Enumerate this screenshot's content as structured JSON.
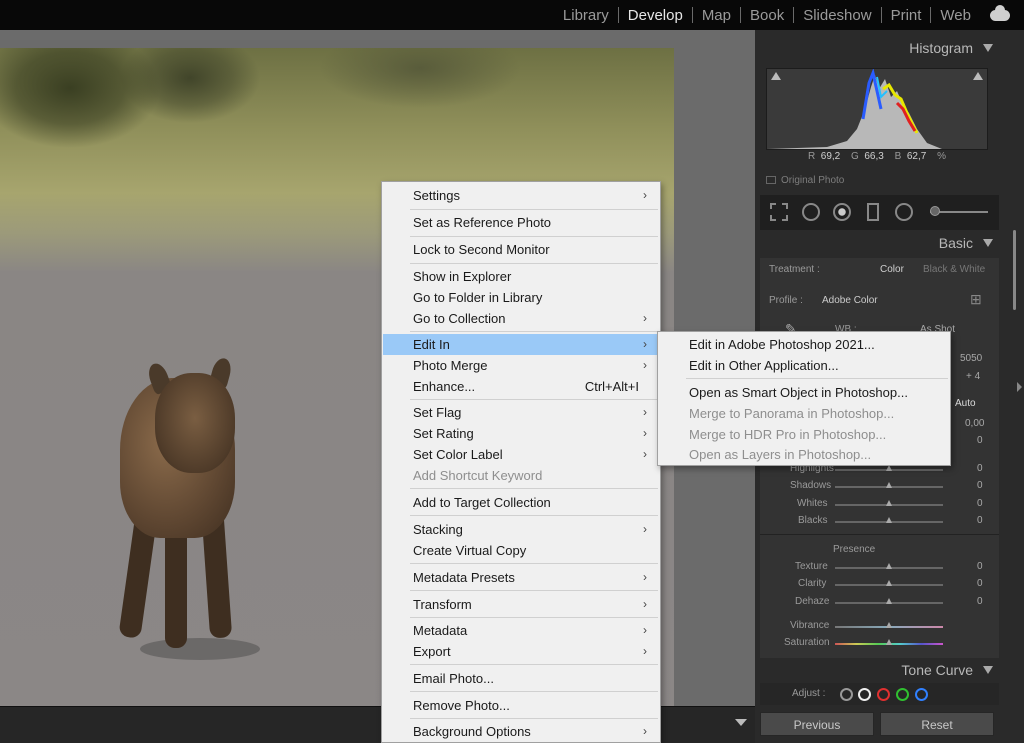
{
  "modules": [
    "Library",
    "Develop",
    "Map",
    "Book",
    "Slideshow",
    "Print",
    "Web"
  ],
  "active_module": "Develop",
  "panel": {
    "histogram_label": "Histogram",
    "rgb": {
      "r_label": "R",
      "r": "69,2",
      "g_label": "G",
      "g": "66,3",
      "b_label": "B",
      "b": "62,7",
      "unit": "%"
    },
    "original_photo": "Original Photo",
    "basic_label": "Basic",
    "treatment_label": "Treatment :",
    "treatment_color": "Color",
    "treatment_bw": "Black & White",
    "profile_label": "Profile :",
    "profile_value": "Adobe Color",
    "wb_label": "WB :",
    "wb_value": "As Shot",
    "temp_value": "5050",
    "tint_value": "+ 4",
    "auto_label": "Auto",
    "exposure_value": "0,00",
    "contrast_value": "0",
    "sliders": [
      {
        "label": "Highlights",
        "value": "0"
      },
      {
        "label": "Shadows",
        "value": "0"
      },
      {
        "label": "Whites",
        "value": "0"
      },
      {
        "label": "Blacks",
        "value": "0"
      }
    ],
    "presence_label": "Presence",
    "presence_sliders": [
      {
        "label": "Texture",
        "value": "0"
      },
      {
        "label": "Clarity",
        "value": "0"
      },
      {
        "label": "Dehaze",
        "value": "0"
      },
      {
        "label": "Vibrance",
        "value": ""
      },
      {
        "label": "Saturation",
        "value": ""
      }
    ],
    "tone_curve_label": "Tone Curve",
    "adjust_label": "Adjust :",
    "previous_label": "Previous",
    "reset_label": "Reset"
  },
  "context_menu": {
    "items": [
      {
        "label": "Settings",
        "submenu": true
      },
      {
        "label": "Set as Reference Photo"
      },
      {
        "label": "Lock to Second Monitor"
      },
      {
        "label": "Show in Explorer"
      },
      {
        "label": "Go to Folder in Library"
      },
      {
        "label": "Go to Collection",
        "submenu": true
      },
      {
        "label": "Edit In",
        "submenu": true,
        "highlighted": true
      },
      {
        "label": "Photo Merge",
        "submenu": true
      },
      {
        "label": "Enhance...",
        "shortcut": "Ctrl+Alt+I"
      },
      {
        "label": "Set Flag",
        "submenu": true
      },
      {
        "label": "Set Rating",
        "submenu": true
      },
      {
        "label": "Set Color Label",
        "submenu": true
      },
      {
        "label": "Add Shortcut Keyword",
        "disabled": true
      },
      {
        "label": "Add to Target Collection"
      },
      {
        "label": "Stacking",
        "submenu": true
      },
      {
        "label": "Create Virtual Copy"
      },
      {
        "label": "Metadata Presets",
        "submenu": true
      },
      {
        "label": "Transform",
        "submenu": true
      },
      {
        "label": "Metadata",
        "submenu": true
      },
      {
        "label": "Export",
        "submenu": true
      },
      {
        "label": "Email Photo..."
      },
      {
        "label": "Remove Photo..."
      },
      {
        "label": "Background Options",
        "submenu": true
      }
    ]
  },
  "edit_in_submenu": {
    "items": [
      {
        "label": "Edit in Adobe Photoshop 2021..."
      },
      {
        "label": "Edit in Other Application..."
      },
      {
        "label": "Open as Smart Object in Photoshop..."
      },
      {
        "label": "Merge to Panorama in Photoshop...",
        "disabled": true
      },
      {
        "label": "Merge to HDR Pro in Photoshop...",
        "disabled": true
      },
      {
        "label": "Open as Layers in Photoshop...",
        "disabled": true
      }
    ]
  },
  "colors": {
    "menu_highlight": "#9ac9f7",
    "menu_bg": "#f0f0f0",
    "panel_bg": "#2a2a2a"
  },
  "icons": [
    "cloud-icon",
    "crop-icon",
    "spot-removal-icon",
    "red-eye-icon",
    "graduated-filter-icon",
    "radial-filter-icon",
    "brush-slider-icon",
    "eyedropper-icon",
    "grid-icon",
    "submenu-arrow-icon",
    "collapse-triangle-icon"
  ]
}
